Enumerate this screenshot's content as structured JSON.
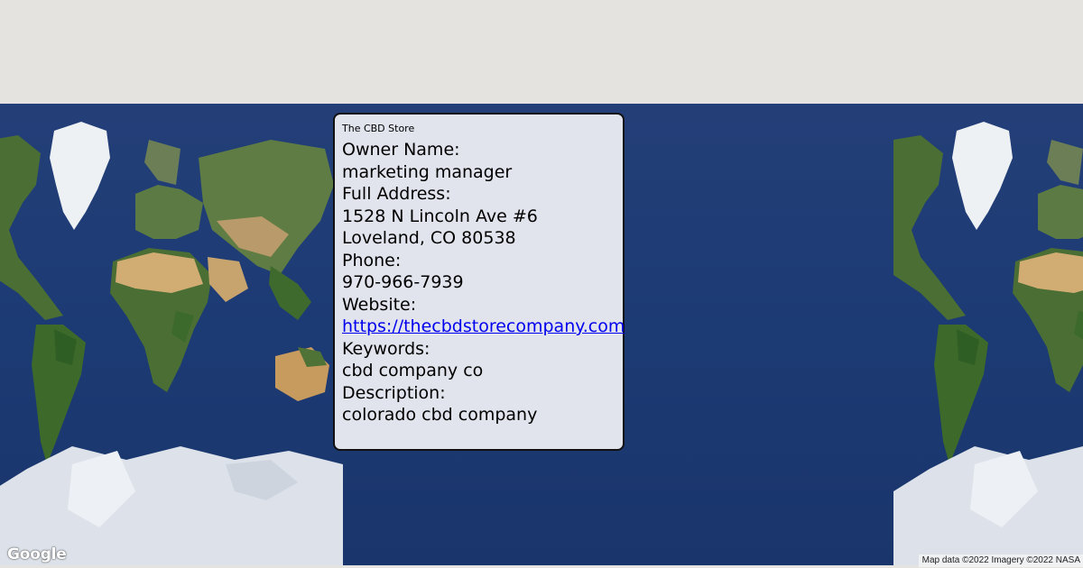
{
  "map": {
    "logo_text": "Google",
    "attribution": "Map data ©2022 Imagery ©2022 NASA",
    "ocean_color": "#1d3a73",
    "land_color": "#3f6a2d",
    "desert_color": "#c9a46a",
    "ice_color": "#dfe3ea"
  },
  "card": {
    "title": "The CBD Store",
    "owner_label": "Owner Name:",
    "owner_value": "marketing manager",
    "address_label": "Full Address:",
    "address_line1": "1528 N Lincoln Ave #6",
    "address_line2": "Loveland, CO 80538",
    "phone_label": "Phone:",
    "phone_value": "970-966-7939",
    "website_label": "Website:",
    "website_value": "https://thecbdstorecompany.com",
    "keywords_label": "Keywords:",
    "keywords_value": "cbd company co",
    "description_label": "Description:",
    "description_value": "colorado cbd company"
  }
}
